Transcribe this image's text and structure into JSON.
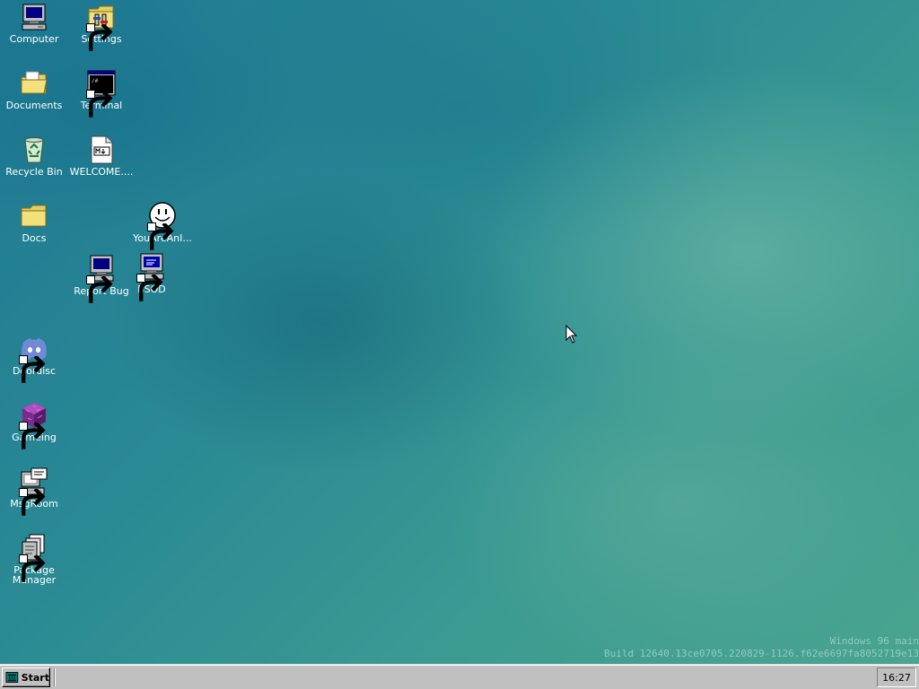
{
  "desktop": {
    "icons": {
      "computer": {
        "label": "Computer",
        "icon": "computer-icon"
      },
      "settings": {
        "label": "Settings",
        "icon": "settings-folder-icon"
      },
      "documents": {
        "label": "Documents",
        "icon": "documents-folder-icon"
      },
      "terminal": {
        "label": "Terminal",
        "icon": "terminal-icon"
      },
      "recycle_bin": {
        "label": "Recycle Bin",
        "icon": "recycle-bin-icon"
      },
      "welcome": {
        "label": "WELCOME....",
        "icon": "markdown-file-icon"
      },
      "docs": {
        "label": "Docs",
        "icon": "folder-icon"
      },
      "youareani": {
        "label": "YouAreAnI...",
        "icon": "smiley-icon"
      },
      "report_bug": {
        "label": "Report Bug",
        "icon": "computer-icon"
      },
      "bsod": {
        "label": "BSOD",
        "icon": "bsod-computer-icon"
      },
      "doordisc": {
        "label": "Doordisc",
        "icon": "discord-icon"
      },
      "gameing": {
        "label": "Gameing",
        "icon": "purple-cube-icon"
      },
      "msgroom": {
        "label": "MsgRoom",
        "icon": "chat-computer-icon"
      },
      "package_manager": {
        "label": "Package\nManager",
        "icon": "package-manager-icon"
      }
    }
  },
  "watermark": {
    "line1": "Windows 96 main",
    "line2": "Build 12640.13ce0705.220829-1126.f62e6697fa8052719e13"
  },
  "taskbar": {
    "start_label": "Start",
    "clock": "16:27"
  },
  "colors": {
    "desktop_base": "#2b8e92",
    "taskbar": "#c0c0c0"
  }
}
